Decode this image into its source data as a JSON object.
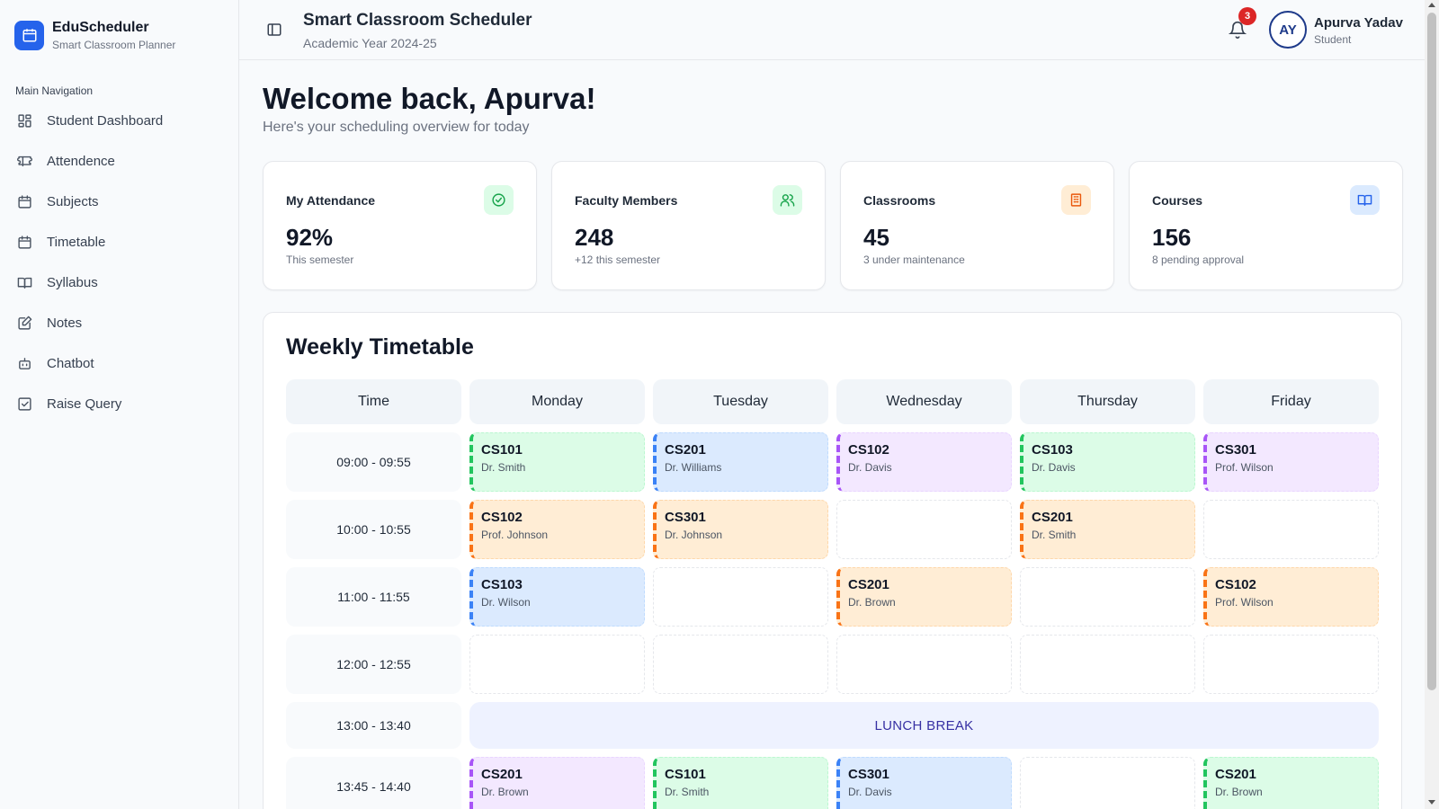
{
  "brand": {
    "title": "EduScheduler",
    "subtitle": "Smart Classroom Planner"
  },
  "nav": {
    "heading": "Main Navigation",
    "items": [
      {
        "label": "Student Dashboard",
        "icon": "grid-icon"
      },
      {
        "label": "Attendence",
        "icon": "ticket-icon"
      },
      {
        "label": "Subjects",
        "icon": "calendar-icon"
      },
      {
        "label": "Timetable",
        "icon": "calendar-icon"
      },
      {
        "label": "Syllabus",
        "icon": "book-icon"
      },
      {
        "label": "Notes",
        "icon": "edit-icon"
      },
      {
        "label": "Chatbot",
        "icon": "bot-icon"
      },
      {
        "label": "Raise Query",
        "icon": "check-square-icon"
      }
    ]
  },
  "header": {
    "title": "Smart Classroom Scheduler",
    "subtitle": "Academic Year 2024-25",
    "notification_count": "3",
    "user_initials": "AY",
    "user_name": "Apurva Yadav",
    "user_role": "Student"
  },
  "welcome": {
    "title": "Welcome back, Apurva!",
    "subtitle": "Here's your scheduling overview for today"
  },
  "stats": [
    {
      "title": "My Attendance",
      "value": "92%",
      "note": "This semester",
      "icon": "check-circle-icon",
      "color": "#16a34a",
      "bg": "#dcfce7"
    },
    {
      "title": "Faculty Members",
      "value": "248",
      "note": "+12 this semester",
      "icon": "users-icon",
      "color": "#16a34a",
      "bg": "#dcfce7"
    },
    {
      "title": "Classrooms",
      "value": "45",
      "note": "3 under maintenance",
      "icon": "building-icon",
      "color": "#ea580c",
      "bg": "#ffedd5"
    },
    {
      "title": "Courses",
      "value": "156",
      "note": "8 pending approval",
      "icon": "book-open-icon",
      "color": "#2563eb",
      "bg": "#dbeafe"
    }
  ],
  "timetable": {
    "title": "Weekly Timetable",
    "headers": [
      "Time",
      "Monday",
      "Tuesday",
      "Wednesday",
      "Thursday",
      "Friday"
    ],
    "lunch_label": "LUNCH BREAK",
    "rows": [
      {
        "time": "09:00 - 09:55",
        "slots": [
          {
            "code": "CS101",
            "teacher": "Dr. Smith",
            "color": "green"
          },
          {
            "code": "CS201",
            "teacher": "Dr. Williams",
            "color": "blue"
          },
          {
            "code": "CS102",
            "teacher": "Dr. Davis",
            "color": "purple"
          },
          {
            "code": "CS103",
            "teacher": "Dr. Davis",
            "color": "green"
          },
          {
            "code": "CS301",
            "teacher": "Prof. Wilson",
            "color": "purple"
          }
        ]
      },
      {
        "time": "10:00 - 10:55",
        "slots": [
          {
            "code": "CS102",
            "teacher": "Prof. Johnson",
            "color": "orange"
          },
          {
            "code": "CS301",
            "teacher": "Dr. Johnson",
            "color": "orange"
          },
          null,
          {
            "code": "CS201",
            "teacher": "Dr. Smith",
            "color": "orange"
          },
          null
        ]
      },
      {
        "time": "11:00 - 11:55",
        "slots": [
          {
            "code": "CS103",
            "teacher": "Dr. Wilson",
            "color": "blue"
          },
          null,
          {
            "code": "CS201",
            "teacher": "Dr. Brown",
            "color": "orange"
          },
          null,
          {
            "code": "CS102",
            "teacher": "Prof. Wilson",
            "color": "orange"
          }
        ]
      },
      {
        "time": "12:00 - 12:55",
        "slots": [
          null,
          null,
          null,
          null,
          null
        ]
      },
      {
        "time": "13:00 - 13:40",
        "lunch": true
      },
      {
        "time": "13:45 - 14:40",
        "slots": [
          {
            "code": "CS201",
            "teacher": "Dr. Brown",
            "color": "purple"
          },
          {
            "code": "CS101",
            "teacher": "Dr. Smith",
            "color": "green"
          },
          {
            "code": "CS301",
            "teacher": "Dr. Davis",
            "color": "blue"
          },
          null,
          {
            "code": "CS201",
            "teacher": "Dr. Brown",
            "color": "green"
          }
        ]
      }
    ]
  }
}
